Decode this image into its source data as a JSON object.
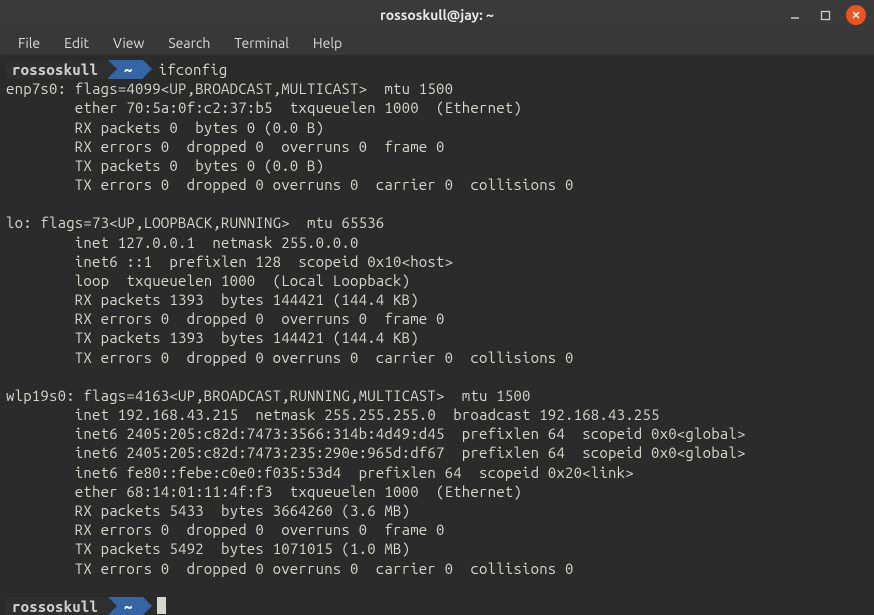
{
  "window": {
    "title": "rossoskull@jay: ~"
  },
  "menu": {
    "file": "File",
    "edit": "Edit",
    "view": "View",
    "search": "Search",
    "terminal": "Terminal",
    "help": "Help"
  },
  "prompt": {
    "user": "rossoskull",
    "path": "~",
    "command": "ifconfig"
  },
  "output": {
    "enp7s0_header": "enp7s0: flags=4099<UP,BROADCAST,MULTICAST>  mtu 1500",
    "enp7s0_ether": "        ether 70:5a:0f:c2:37:b5  txqueuelen 1000  (Ethernet)",
    "enp7s0_rx1": "        RX packets 0  bytes 0 (0.0 B)",
    "enp7s0_rx2": "        RX errors 0  dropped 0  overruns 0  frame 0",
    "enp7s0_tx1": "        TX packets 0  bytes 0 (0.0 B)",
    "enp7s0_tx2": "        TX errors 0  dropped 0 overruns 0  carrier 0  collisions 0",
    "lo_header": "lo: flags=73<UP,LOOPBACK,RUNNING>  mtu 65536",
    "lo_inet": "        inet 127.0.0.1  netmask 255.0.0.0",
    "lo_inet6": "        inet6 ::1  prefixlen 128  scopeid 0x10<host>",
    "lo_loop": "        loop  txqueuelen 1000  (Local Loopback)",
    "lo_rx1": "        RX packets 1393  bytes 144421 (144.4 KB)",
    "lo_rx2": "        RX errors 0  dropped 0  overruns 0  frame 0",
    "lo_tx1": "        TX packets 1393  bytes 144421 (144.4 KB)",
    "lo_tx2": "        TX errors 0  dropped 0 overruns 0  carrier 0  collisions 0",
    "wlp_header": "wlp19s0: flags=4163<UP,BROADCAST,RUNNING,MULTICAST>  mtu 1500",
    "wlp_inet": "        inet 192.168.43.215  netmask 255.255.255.0  broadcast 192.168.43.255",
    "wlp_inet6a": "        inet6 2405:205:c82d:7473:3566:314b:4d49:d45  prefixlen 64  scopeid 0x0<global>",
    "wlp_inet6b": "        inet6 2405:205:c82d:7473:235:290e:965d:df67  prefixlen 64  scopeid 0x0<global>",
    "wlp_inet6c": "        inet6 fe80::febe:c0e0:f035:53d4  prefixlen 64  scopeid 0x20<link>",
    "wlp_ether": "        ether 68:14:01:11:4f:f3  txqueuelen 1000  (Ethernet)",
    "wlp_rx1": "        RX packets 5433  bytes 3664260 (3.6 MB)",
    "wlp_rx2": "        RX errors 0  dropped 0  overruns 0  frame 0",
    "wlp_tx1": "        TX packets 5492  bytes 1071015 (1.0 MB)",
    "wlp_tx2": "        TX errors 0  dropped 0 overruns 0  carrier 0  collisions 0"
  },
  "prompt2": {
    "user": "rossoskull",
    "path": "~"
  }
}
